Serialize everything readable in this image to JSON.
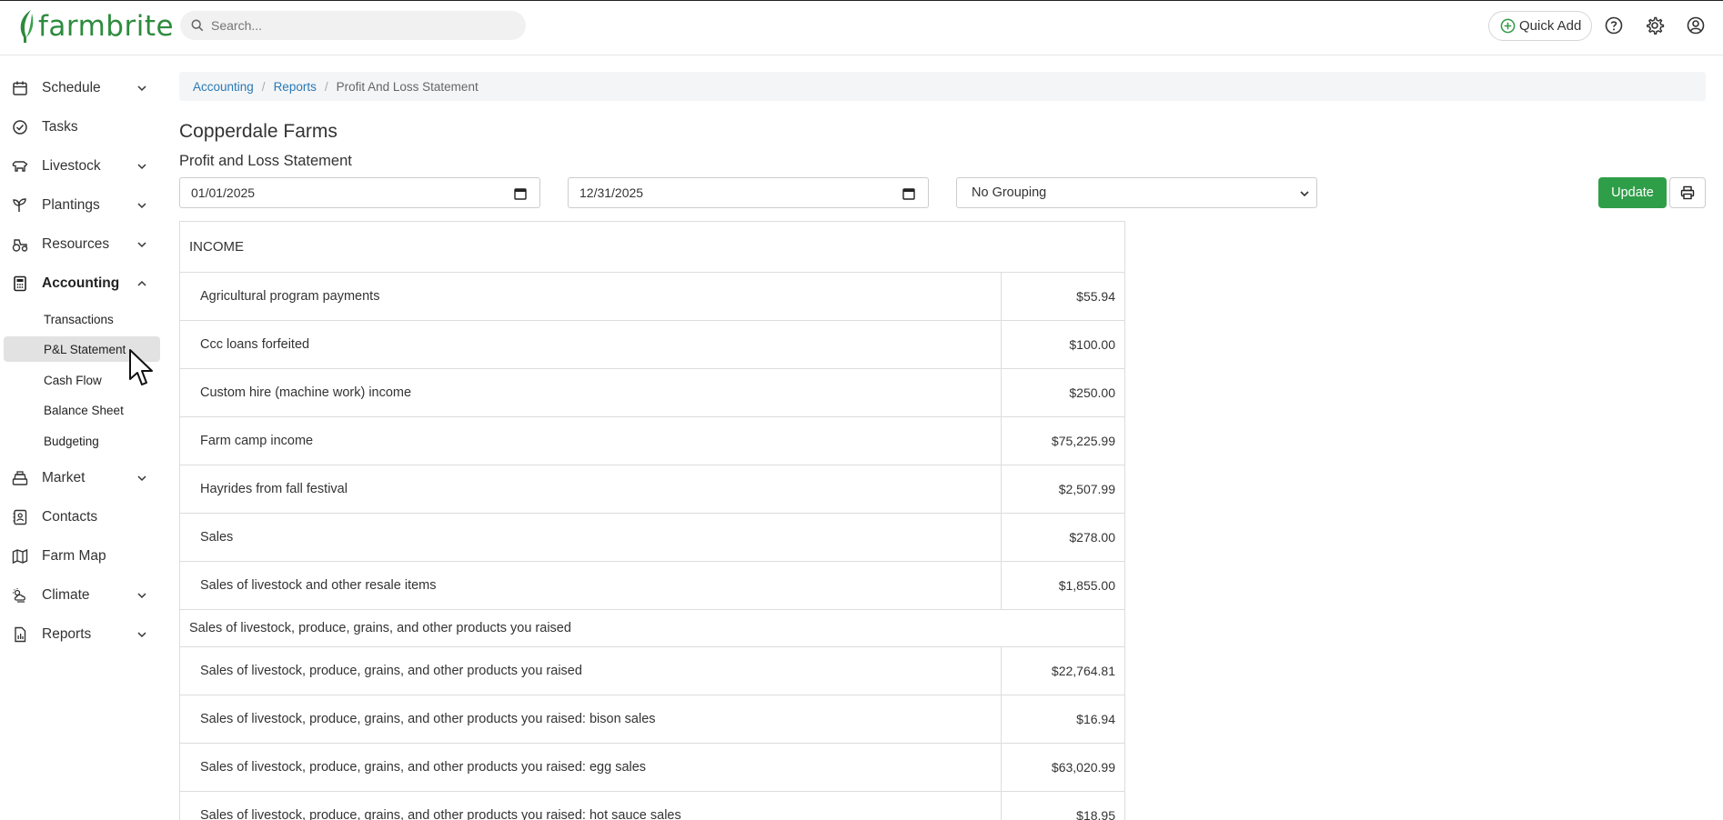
{
  "app": {
    "logo_text": "farmbrite"
  },
  "header": {
    "search_placeholder": "Search...",
    "quick_add_label": "Quick Add"
  },
  "sidebar": {
    "items": [
      {
        "label": "Schedule",
        "icon": "calendar-icon",
        "has_chevron": true
      },
      {
        "label": "Tasks",
        "icon": "check-circle-icon",
        "has_chevron": false
      },
      {
        "label": "Livestock",
        "icon": "livestock-icon",
        "has_chevron": true
      },
      {
        "label": "Plantings",
        "icon": "sprout-icon",
        "has_chevron": true
      },
      {
        "label": "Resources",
        "icon": "tractor-icon",
        "has_chevron": true
      },
      {
        "label": "Accounting",
        "icon": "calculator-icon",
        "has_chevron": true,
        "expanded": true
      },
      {
        "label": "Market",
        "icon": "register-icon",
        "has_chevron": true
      },
      {
        "label": "Contacts",
        "icon": "contact-book-icon",
        "has_chevron": false
      },
      {
        "label": "Farm Map",
        "icon": "map-icon",
        "has_chevron": false
      },
      {
        "label": "Climate",
        "icon": "weather-icon",
        "has_chevron": true
      },
      {
        "label": "Reports",
        "icon": "report-file-icon",
        "has_chevron": true
      }
    ],
    "accounting_sub": [
      {
        "label": "Transactions"
      },
      {
        "label": "P&L Statement",
        "selected": true
      },
      {
        "label": "Cash Flow"
      },
      {
        "label": "Balance Sheet"
      },
      {
        "label": "Budgeting"
      }
    ]
  },
  "breadcrumb": {
    "items": [
      "Accounting",
      "Reports"
    ],
    "current": "Profit And Loss Statement",
    "separator": "/"
  },
  "page": {
    "farm_name": "Copperdale Farms",
    "report_title": "Profit and Loss Statement",
    "start_date": "01/01/2025",
    "end_date": "12/31/2025",
    "grouping": "No Grouping",
    "update_label": "Update"
  },
  "report": {
    "section_title": "INCOME",
    "rows": [
      {
        "name": "Agricultural program payments",
        "value": "$55.94"
      },
      {
        "name": "Ccc loans forfeited",
        "value": "$100.00"
      },
      {
        "name": "Custom hire (machine work) income",
        "value": "$250.00"
      },
      {
        "name": "Farm camp income",
        "value": "$75,225.99"
      },
      {
        "name": "Hayrides from fall festival",
        "value": "$2,507.99"
      },
      {
        "name": "Sales",
        "value": "$278.00"
      },
      {
        "name": "Sales of livestock and other resale items",
        "value": "$1,855.00"
      }
    ],
    "group_title": "Sales of livestock, produce, grains, and other products you raised",
    "group_rows": [
      {
        "name": "Sales of livestock, produce, grains, and other products you raised",
        "value": "$22,764.81"
      },
      {
        "name": "Sales of livestock, produce, grains, and other products you raised: bison sales",
        "value": "$16.94"
      },
      {
        "name": "Sales of livestock, produce, grains, and other products you raised: egg sales",
        "value": "$63,020.99"
      },
      {
        "name": "Sales of livestock, produce, grains, and other products you raised: hot sauce sales",
        "value": "$18.95"
      }
    ]
  },
  "colors": {
    "brand_green": "#2e8b3e",
    "button_green": "#2f9e49",
    "link_blue": "#2a79b5"
  }
}
